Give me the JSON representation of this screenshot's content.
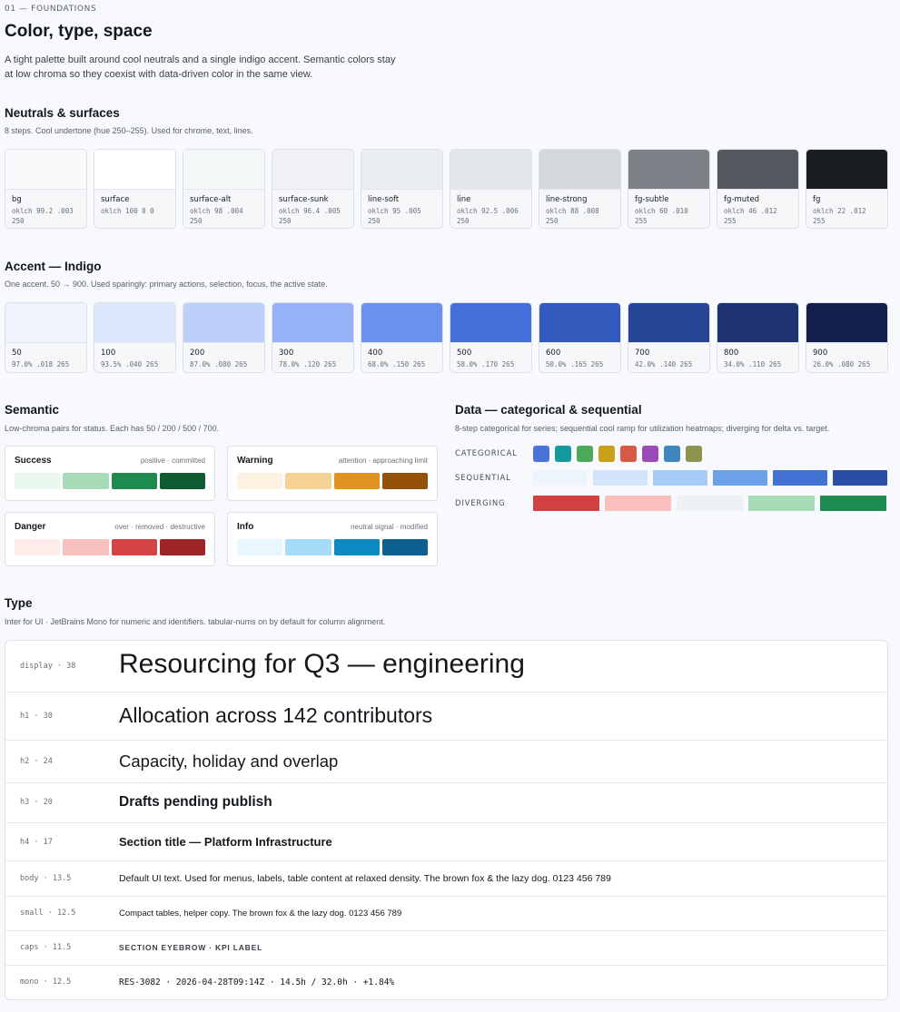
{
  "eyebrow": "01 — FOUNDATIONS",
  "title": "Color, type, space",
  "intro": "A tight palette built around cool neutrals and a single indigo accent. Semantic colors stay at low chroma so they coexist with data-driven color in the same view.",
  "neutrals": {
    "title": "Neutrals & surfaces",
    "subtitle": "8 steps. Cool undertone (hue 250–255). Used for chrome, text, lines.",
    "swatches": [
      {
        "name": "bg",
        "value": "oklch 99.2 .003 250",
        "color": "#f8fafc"
      },
      {
        "name": "surface",
        "value": "oklch 100 0 0",
        "color": "#ffffff"
      },
      {
        "name": "surface-alt",
        "value": "oklch 98 .004 250",
        "color": "#f4f7f8"
      },
      {
        "name": "surface-sunk",
        "value": "oklch 96.4 .005 250",
        "color": "#eff1f4"
      },
      {
        "name": "line-soft",
        "value": "oklch 95 .005 250",
        "color": "#ebeef1"
      },
      {
        "name": "line",
        "value": "oklch 92.5 .006 250",
        "color": "#e3e6ea"
      },
      {
        "name": "line-strong",
        "value": "oklch 88 .008 250",
        "color": "#d4d8dd"
      },
      {
        "name": "fg-subtle",
        "value": "oklch 60 .010 255",
        "color": "#7c8087"
      },
      {
        "name": "fg-muted",
        "value": "oklch 46 .012 255",
        "color": "#55595f"
      },
      {
        "name": "fg",
        "value": "oklch 22 .012 255",
        "color": "#1a1e22"
      }
    ]
  },
  "accent": {
    "title": "Accent — Indigo",
    "subtitle": "One accent. 50 → 900. Used sparingly: primary actions, selection, focus, the active state.",
    "swatches": [
      {
        "name": "50",
        "value": "97.0% .018 265",
        "color": "#eef3fe"
      },
      {
        "name": "100",
        "value": "93.5% .040 265",
        "color": "#dde8fc"
      },
      {
        "name": "200",
        "value": "87.0% .080 265",
        "color": "#bcd0fa"
      },
      {
        "name": "300",
        "value": "78.0% .120 265",
        "color": "#93b3f6"
      },
      {
        "name": "400",
        "value": "68.0% .150 265",
        "color": "#6a91ee"
      },
      {
        "name": "500",
        "value": "58.0% .170 265",
        "color": "#4570da"
      },
      {
        "name": "600",
        "value": "50.0% .165 265",
        "color": "#3459bd"
      },
      {
        "name": "700",
        "value": "42.0% .140 265",
        "color": "#274597"
      },
      {
        "name": "800",
        "value": "34.0% .110 265",
        "color": "#1d3371"
      },
      {
        "name": "900",
        "value": "26.0% .080 265",
        "color": "#14204b"
      }
    ]
  },
  "semantic": {
    "title": "Semantic",
    "subtitle": "Low-chroma pairs for status. Each has 50 / 200 / 500 / 700.",
    "cards": [
      {
        "title": "Success",
        "desc": "positive · committed",
        "colors": [
          "#e9f8ee",
          "#a8dcb8",
          "#1f8a50",
          "#0f5c32"
        ]
      },
      {
        "title": "Warning",
        "desc": "attention · approaching limit",
        "colors": [
          "#fdf2e2",
          "#f6d194",
          "#e0931f",
          "#945208"
        ]
      },
      {
        "title": "Danger",
        "desc": "over · removed · destructive",
        "colors": [
          "#fdecea",
          "#f7c0bd",
          "#d44444",
          "#9e2428"
        ]
      },
      {
        "title": "Info",
        "desc": "neutral signal · modified",
        "colors": [
          "#e8f6fd",
          "#a6dcf8",
          "#0b8ac1",
          "#0c5f8e"
        ]
      }
    ]
  },
  "data": {
    "title": "Data — categorical & sequential",
    "subtitle": "8-step categorical for series; sequential cool ramp for utilization heatmaps; diverging for delta vs. target.",
    "categorical_label": "CATEGORICAL",
    "sequential_label": "SEQUENTIAL",
    "diverging_label": "DIVERGING",
    "categorical": [
      "#4a72d8",
      "#14999c",
      "#4caa5a",
      "#c9a01a",
      "#d65a47",
      "#9a4bb8",
      "#3d86bd",
      "#8e944e"
    ],
    "sequential": [
      "#eef4fe",
      "#d3e4fc",
      "#a7cbf7",
      "#6aa1ea",
      "#4272d4",
      "#2a4ea6"
    ],
    "diverging": [
      "#d24141",
      "#f9c0bd",
      "#eef1f4",
      "#a8dcb8",
      "#1f8a50"
    ]
  },
  "type": {
    "title": "Type",
    "subtitle": "Inter for UI · JetBrains Mono for numeric and identifiers. tabular-nums on by default for column alignment.",
    "rows": [
      {
        "tag": "display · 38",
        "sample": "Resourcing for Q3 — engineering"
      },
      {
        "tag": "h1 · 30",
        "sample": "Allocation across 142 contributors"
      },
      {
        "tag": "h2 · 24",
        "sample": "Capacity, holiday and overlap"
      },
      {
        "tag": "h3 · 20",
        "sample": "Drafts pending publish"
      },
      {
        "tag": "h4 · 17",
        "sample": "Section title — Platform Infrastructure"
      },
      {
        "tag": "body · 13.5",
        "sample": "Default UI text. Used for menus, labels, table content at relaxed density. The brown fox & the lazy dog. 0123 456 789"
      },
      {
        "tag": "small · 12.5",
        "sample": "Compact tables, helper copy. The brown fox & the lazy dog. 0123 456 789"
      },
      {
        "tag": "caps · 11.5",
        "sample": "SECTION EYEBROW · KPI LABEL"
      },
      {
        "tag": "mono · 12.5",
        "sample": "RES-3082 · 2026-04-28T09:14Z · 14.5h / 32.0h · +1.84%"
      }
    ]
  }
}
